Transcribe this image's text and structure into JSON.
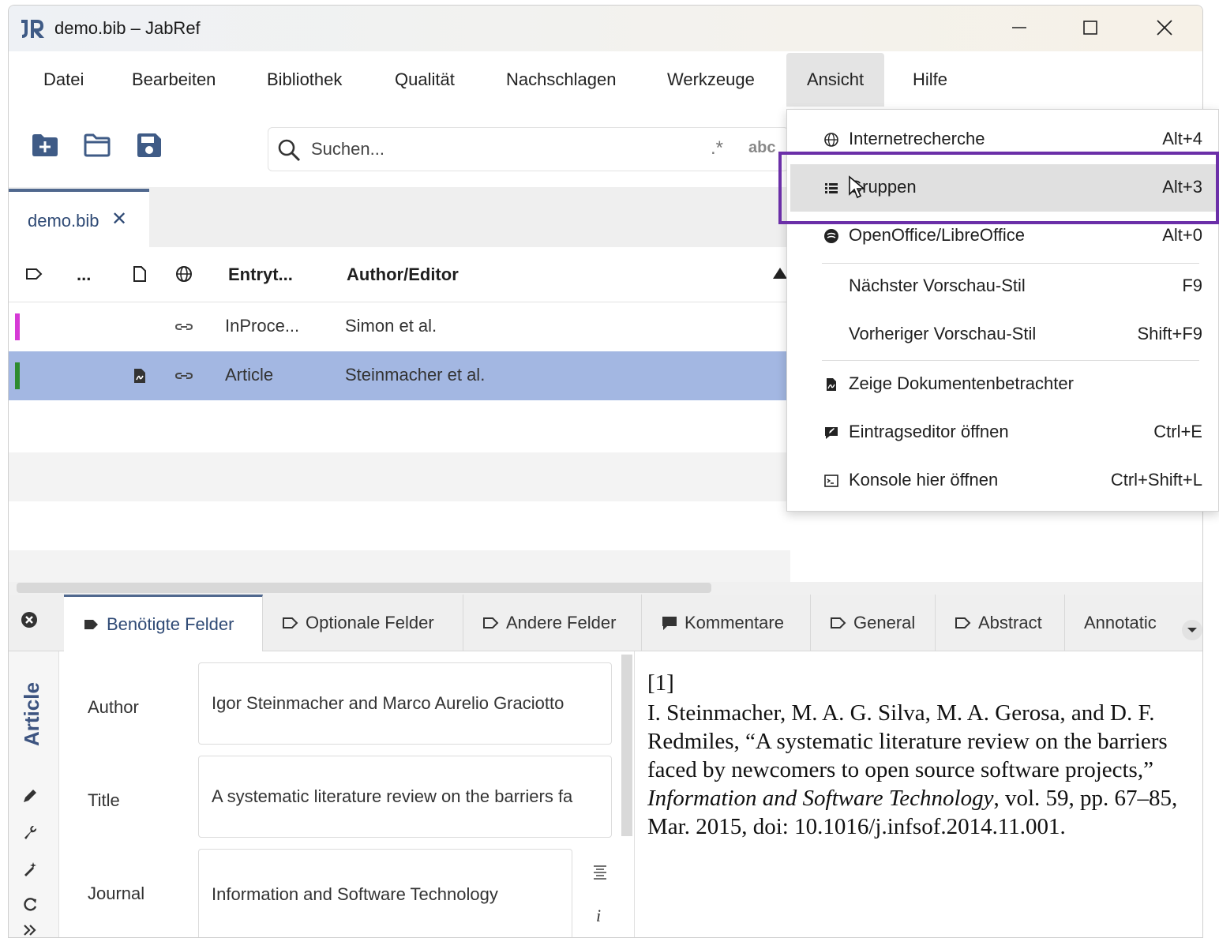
{
  "window": {
    "title": "demo.bib – JabRef",
    "controls": {
      "minimize": "—",
      "maximize": "☐",
      "close": "✕"
    }
  },
  "menubar": {
    "items": [
      "Datei",
      "Bearbeiten",
      "Bibliothek",
      "Qualität",
      "Nachschlagen",
      "Werkzeuge",
      "Ansicht",
      "Hilfe"
    ],
    "active": "Ansicht"
  },
  "toolbar": {
    "icons": [
      "new-library-icon",
      "open-library-icon",
      "save-icon"
    ],
    "search": {
      "placeholder": "Suchen...",
      "value": ""
    },
    "search_options": [
      "regex-icon",
      "case-sensitive-icon"
    ]
  },
  "library_tab": {
    "label": "demo.bib",
    "close": "✕"
  },
  "table": {
    "columns": [
      "Entryt...",
      "Author/Editor"
    ],
    "icon_columns": [
      "group-icon",
      "more-icon",
      "file-icon",
      "web-icon"
    ],
    "rows": [
      {
        "marker_color": "#d63ad6",
        "type": "InProce...",
        "author": "Simon et al.",
        "has_file": false,
        "has_link": true,
        "selected": false
      },
      {
        "marker_color": "#2e8b2e",
        "type": "Article",
        "author": "Steinmacher et al.",
        "has_file": true,
        "has_link": true,
        "selected": true
      }
    ]
  },
  "view_menu": {
    "items": [
      {
        "icon": "globe-icon",
        "label": "Internetrecherche",
        "shortcut": "Alt+4"
      },
      {
        "icon": "list-icon",
        "label": "Gruppen",
        "shortcut": "Alt+3",
        "hovered": true
      },
      {
        "icon": "openoffice-icon",
        "label": "OpenOffice/LibreOffice",
        "shortcut": "Alt+0"
      },
      {
        "icon": "",
        "label": "Nächster Vorschau-Stil",
        "shortcut": "F9"
      },
      {
        "icon": "",
        "label": "Vorheriger Vorschau-Stil",
        "shortcut": "Shift+F9"
      },
      {
        "icon": "pdf-icon",
        "label": "Zeige Dokumentenbetrachter",
        "shortcut": ""
      },
      {
        "icon": "edit-entry-icon",
        "label": "Eintragseditor öffnen",
        "shortcut": "Ctrl+E"
      },
      {
        "icon": "console-icon",
        "label": "Konsole hier öffnen",
        "shortcut": "Ctrl+Shift+L"
      }
    ]
  },
  "editor": {
    "tabs": [
      "Benötigte Felder",
      "Optionale Felder",
      "Andere Felder",
      "Kommentare",
      "General",
      "Abstract",
      "Annotatic"
    ],
    "active_tab": "Benötigte Felder",
    "entry_type": "Article",
    "fields": [
      {
        "label": "Author",
        "value": "Igor Steinmacher and Marco Aurelio Graciotto"
      },
      {
        "label": "Title",
        "value": "A systematic literature review on the barriers fa"
      },
      {
        "label": "Journal",
        "value": "Information and Software Technology"
      }
    ],
    "field_side_icons": [
      "format-icon",
      "info-icon"
    ]
  },
  "preview": {
    "number": "[1]",
    "text_before": "I. Steinmacher, M. A. G. Silva, M. A. Gerosa, and D. F. Redmiles, “A systematic literature review on the barriers faced by newcomers to open source software projects,” ",
    "journal": "Information and Software Technology",
    "text_after": ", vol. 59, pp. 67–85, Mar. 2015, doi: 10.1016/j.infsof.2014.11.001."
  },
  "colors": {
    "selection": "#a3b7e2",
    "accent": "#2f4a75",
    "highlight_box": "#6b2fa8"
  }
}
